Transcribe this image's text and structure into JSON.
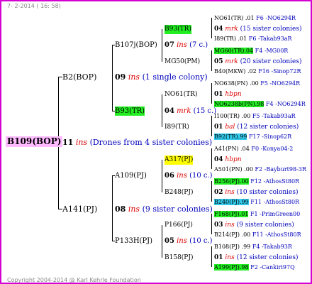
{
  "header": "7- 2-2014 ( 16: 58)",
  "footer": "Copyright 2004-2014 @ Karl Kehrle Foundation",
  "root": {
    "label": "B109(BOP)",
    "gen": "11",
    "ins": "ins",
    "note": "(Drones from 4 sister colonies)"
  },
  "p1": {
    "label": "B2(BOP)",
    "gen": "09",
    "ins": "ins",
    "note": "(1 single colony)"
  },
  "p2": {
    "label": "A141(PJ)",
    "gen": "08",
    "ins": "ins",
    "note": "(9 sister colonies)"
  },
  "p1a": {
    "label": "B107j(BOP)",
    "gen": "07",
    "ins": "ins",
    "note": "(7 c.)"
  },
  "p1b": {
    "label": "B93(TR)",
    "gen": "04",
    "ins": "mrk",
    "note": "(15 c.)"
  },
  "p2a": {
    "label": "A109(PJ)",
    "gen": "06",
    "ins": "ins",
    "note": "(10 c.)"
  },
  "p2b": {
    "label": "P133H(PJ)",
    "gen": "05",
    "ins": "ins",
    "note": "(10 c.)"
  },
  "g3": [
    {
      "label": "B93(TR)",
      "gen": "04",
      "ins": "mrk",
      "note": "(15 sister colonies)"
    },
    {
      "label": "MG50(PM)",
      "gen": "05",
      "ins": "mrk",
      "note": "(20 sister colonies)"
    },
    {
      "label": "NO61(TR)",
      "gen": "01",
      "ins": "hbpn",
      "note": ""
    },
    {
      "label": "I89(TR)",
      "gen": "01",
      "ins": "bal",
      "note": "(12 sister colonies)"
    },
    {
      "label": "A317(PJ)",
      "gen": "04",
      "ins": "hbpn",
      "note": ""
    },
    {
      "label": "B248(PJ)",
      "gen": "02",
      "ins": "ins",
      "note": "(10 sister colonies)"
    },
    {
      "label": "P166(PJ)",
      "gen": "03",
      "ins": "ins",
      "note": "(9 sister colonies)"
    },
    {
      "label": "B158(PJ)",
      "gen": "01",
      "ins": "ins",
      "note": "(12 sister colonies)"
    }
  ],
  "g4": [
    {
      "label": "NO61(TR)",
      "num": ".01",
      "ref": "F6 -NO6294R"
    },
    {
      "label": "I89(TR)",
      "num": ".01",
      "ref": "F6 -Takab93aR"
    },
    {
      "label": "MG60(TR)",
      "num": ".04",
      "ref": "F4 -MG00R"
    },
    {
      "label": "B40(MKW)",
      "num": ".02",
      "ref": "F16 -Sinop72R"
    },
    {
      "label": "NO638(PN)",
      "num": ".00",
      "ref": "F5 -NO6294R"
    },
    {
      "label": "NO6238b(PN)",
      "num": ".98",
      "ref": "F4 -NO6294R"
    },
    {
      "label": "I100(TR)",
      "num": ".00",
      "ref": "F5 -Takab93aR"
    },
    {
      "label": "B92(TR)",
      "num": ".99",
      "ref": "F17 -Sinop62R"
    },
    {
      "label": "A41(PN)",
      "num": ".04",
      "ref": "F0 -Konya04-2"
    },
    {
      "label": "A501(PN)",
      "num": ".00",
      "ref": "F2 -Bayburt98-3R"
    },
    {
      "label": "B256(PJ)",
      "num": ".00",
      "ref": "F12 -AthosSt80R"
    },
    {
      "label": "B240(PJ)",
      "num": ".99",
      "ref": "F11 -AthosSt80R"
    },
    {
      "label": "F168(PJ)",
      "num": ".01",
      "ref": "F1 -PrimGreen00"
    },
    {
      "label": "B214(PJ)",
      "num": ".00",
      "ref": "F11 -AthosSt80R"
    },
    {
      "label": "B108(PJ)",
      "num": ".99",
      "ref": "F4 -Takab93R"
    },
    {
      "label": "A199(PJ)",
      "num": ".98",
      "ref": "F2 -Cankiri97Q"
    }
  ]
}
